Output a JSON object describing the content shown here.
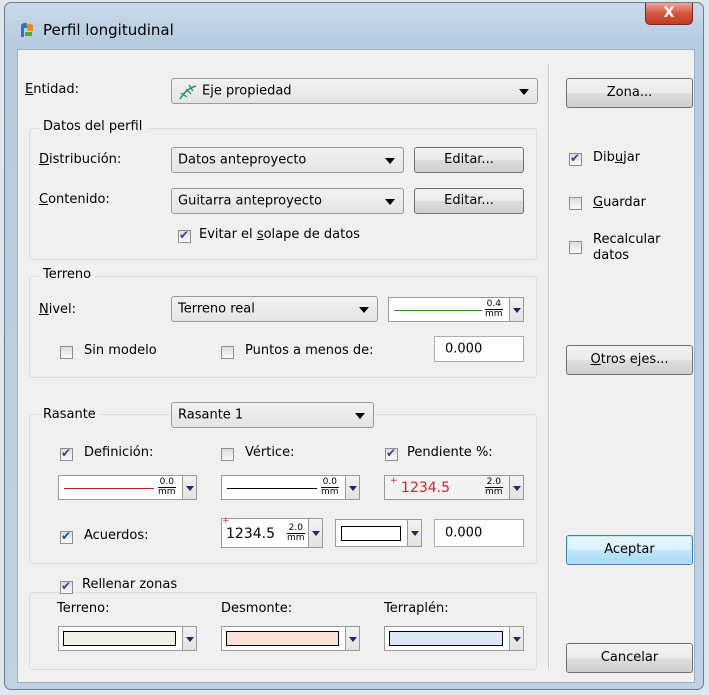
{
  "window": {
    "title": "Perfil longitudinal",
    "close_glyph": "X"
  },
  "entidad": {
    "label_u": "E",
    "label_rest": "ntidad:",
    "value": "Eje propiedad"
  },
  "datos_perfil": {
    "title": "Datos del perfil",
    "distribucion_u": "D",
    "distribucion_rest": "istribución:",
    "distribucion_value": "Datos anteproyecto",
    "distribucion_edit": "Editar...",
    "contenido_u": "C",
    "contenido_rest": "ontenido:",
    "contenido_value": "Guitarra anteproyecto",
    "contenido_edit": "Editar...",
    "evitar_pre": "Evitar el ",
    "evitar_u": "s",
    "evitar_post": "olape de datos"
  },
  "terreno": {
    "title": "Terreno",
    "nivel_u": "N",
    "nivel_rest": "ivel:",
    "nivel_value": "Terreno real",
    "line_top": "0.4",
    "line_unit": "mm",
    "sin_modelo": "Sin modelo",
    "puntos": "Puntos a menos de:",
    "puntos_value": "0.000"
  },
  "rasante": {
    "title": "Rasante",
    "value": "Rasante 1",
    "definicion": "Definición:",
    "vertice": "Vértice:",
    "pendiente": "Pendiente %:",
    "def_top": "0.0",
    "def_unit": "mm",
    "vert_top": "0.0",
    "vert_unit": "mm",
    "pend_text": "1234.5",
    "pend_top": "2.0",
    "pend_unit": "mm",
    "acuerdos": "Acuerdos:",
    "acu_text": "1234.5",
    "acu_top": "2.0",
    "acu_unit": "mm",
    "acu_value": "0.000"
  },
  "rellenar": {
    "title": "Rellenar zonas",
    "terreno": "Terreno:",
    "desmonte": "Desmonte:",
    "terraplen": "Terraplén:",
    "terreno_color": "#eef2e6",
    "desmonte_color": "#fbe0da",
    "terraplen_color": "#dde8f5"
  },
  "side": {
    "zona": "Zona...",
    "dibujar_pre": "Dib",
    "dibujar_u": "u",
    "dibujar_post": "jar",
    "guardar_u": "G",
    "guardar_rest": "uardar",
    "recalcular1": "Recalcular",
    "recalcular2": "datos",
    "otros_u": "O",
    "otros_rest": "tros ejes...",
    "aceptar": "Aceptar",
    "cancelar": "Cancelar"
  }
}
